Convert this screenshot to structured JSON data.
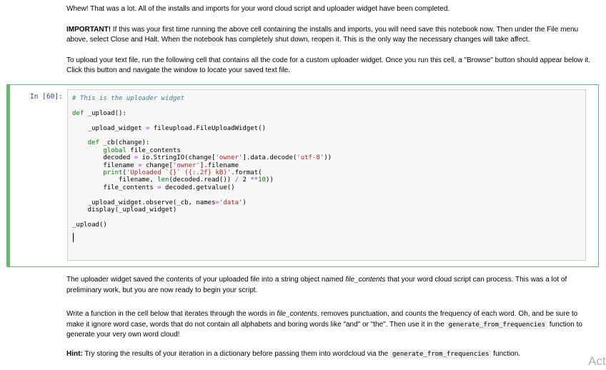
{
  "markdown_top": {
    "p1": "Whew! That was a lot. All of the installs and imports for your word cloud script and uploader widget have been completed.",
    "p2_bold": "IMPORTANT!",
    "p2_text": " If this was your first time running the above cell containing the installs and imports, you will need save this notebook now. Then under the File menu above, select Close and Halt. When the notebook has completely shut down, reopen it. This is the only way the necessary changes will take affect.",
    "p3": "To upload your text file, run the following cell that contains all the code for a custom uploader widget. Once you run this cell, a \"Browse\" button should appear below it. Click this button and navigate the window to locate your saved text file."
  },
  "code_cell": {
    "prompt": "In [60]:",
    "lines": {
      "comment": "# This is the uploader widget",
      "def1_kw": "def",
      "def1_rest": " _upload():",
      "l_widget_a": "    _upload_widget ",
      "l_widget_op": "=",
      "l_widget_b": " fileupload.FileUploadWidget()",
      "def2_indent": "    ",
      "def2_kw": "def",
      "def2_rest": " _cb(change):",
      "global_indent": "        ",
      "global_kw": "global",
      "global_rest": " file_contents",
      "dec_a": "        decoded ",
      "dec_op": "=",
      "dec_b": " io.StringIO(change[",
      "dec_s1": "'owner'",
      "dec_c": "].data.decode(",
      "dec_s2": "'utf-8'",
      "dec_d": "))",
      "fn_a": "        filename ",
      "fn_op": "=",
      "fn_b": " change[",
      "fn_s": "'owner'",
      "fn_c": "].filename",
      "pr_indent": "        ",
      "pr_kw": "print",
      "pr_a": "(",
      "pr_s": "'Uploaded `{}` ({:.2f} kB)'",
      "pr_b": ".format(",
      "len_a": "            filename, ",
      "len_kw": "len",
      "len_b": "(decoded.read()) ",
      "len_op1": "/",
      "len_c": " 2 ",
      "len_op2": "**",
      "len_num": "10",
      "len_d": "))",
      "fc_a": "        file_contents ",
      "fc_op": "=",
      "fc_b": " decoded.getvalue()",
      "obs_a": "    _upload_widget.observe(_cb, names",
      "obs_op": "=",
      "obs_s": "'data'",
      "obs_b": ")",
      "disp": "    display(_upload_widget)",
      "call": "_upload()"
    }
  },
  "markdown_bottom": {
    "p1_a": "The uploader widget saved the contents of your uploaded file into a string object named ",
    "p1_i": "file_contents",
    "p1_b": " that your word cloud script can process. This was a lot of preliminary work, but you are now ready to begin your script.",
    "p2_a": "Write a function in the cell below that iterates through the words in ",
    "p2_i": "file_contents",
    "p2_b": ", removes punctuation, and counts the frequency of each word. Oh, and be sure to make it ignore word case, words that do not contain all alphabets and boring words like \"and\" or \"the\". Then use it in the ",
    "p2_code": "generate_from_frequencies",
    "p2_c": " function to generate your very own word cloud!",
    "p3_bold": "Hint:",
    "p3_a": " Try storing the results of your iteration in a dictionary before passing them into wordcloud via the ",
    "p3_code": "generate_from_frequencies",
    "p3_b": " function."
  },
  "watermark": "Act"
}
